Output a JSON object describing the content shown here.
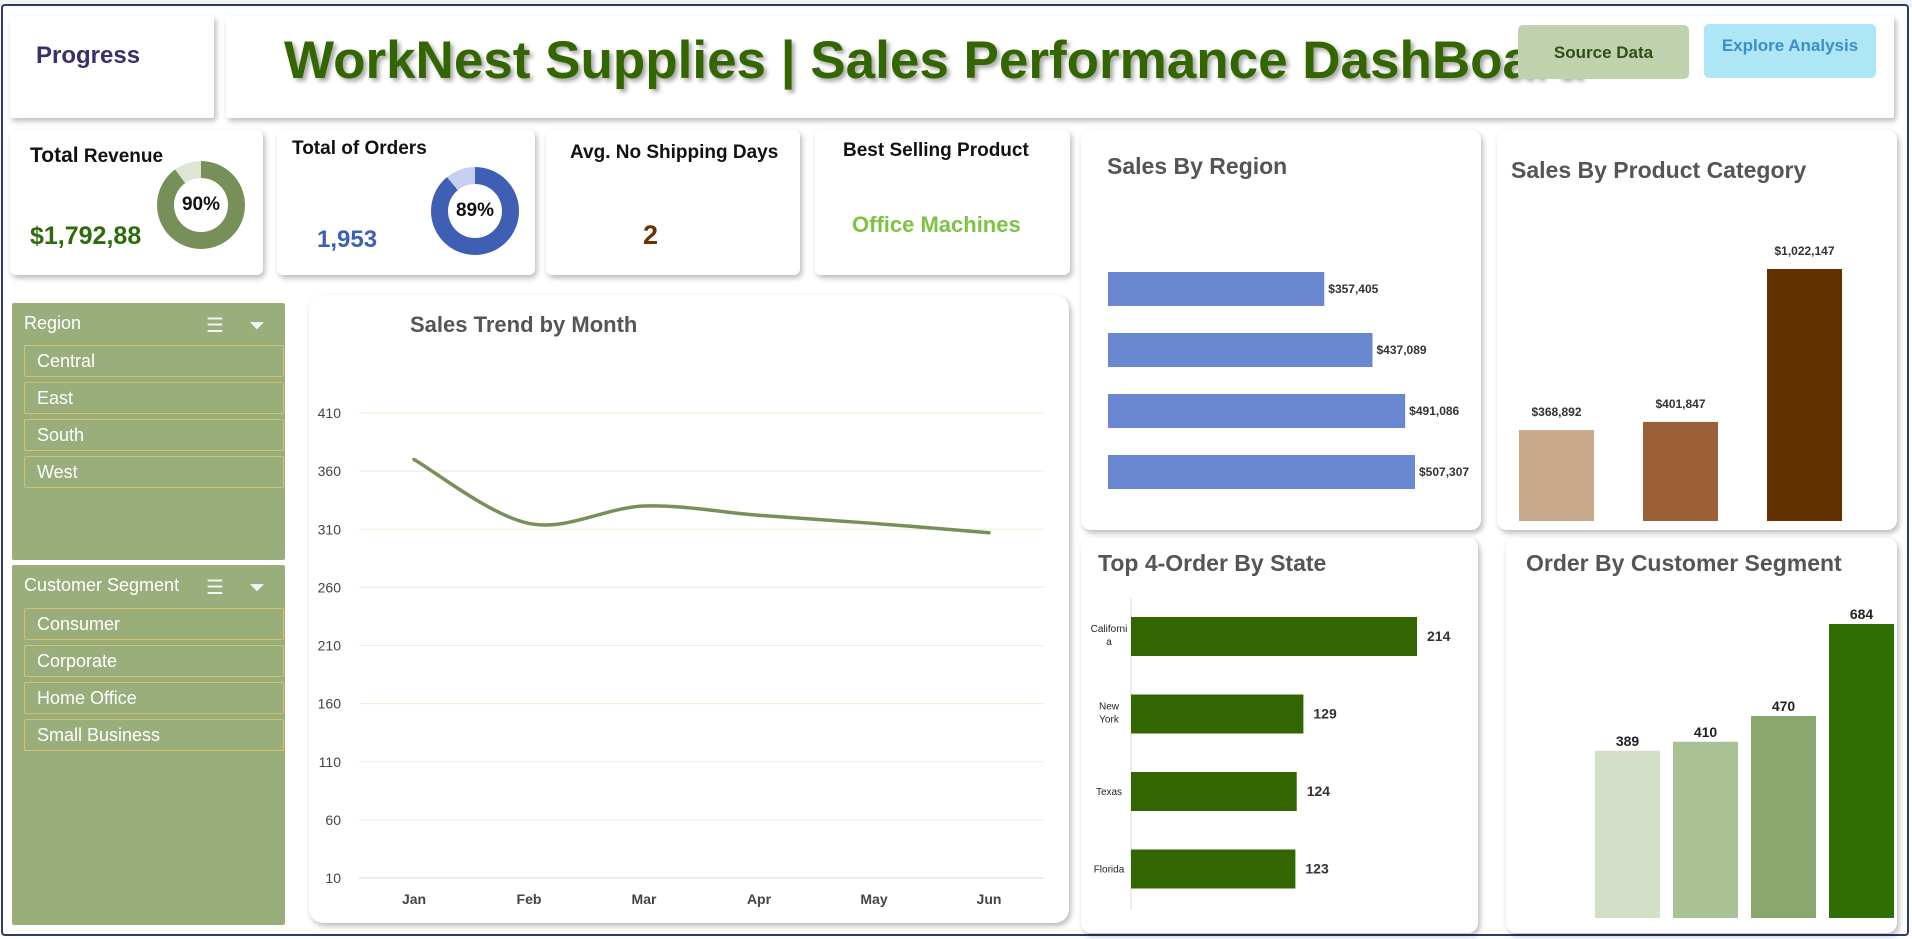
{
  "header": {
    "progress_label": "Progress",
    "title": "WorkNest Supplies | Sales Performance DashBoard",
    "source_button": "Source Data",
    "explore_button": "Explore Analysis"
  },
  "kpis": {
    "revenue": {
      "title_a": "Total",
      "title_b": " Revenue",
      "value": "$1,792,88",
      "percent_label": "90%",
      "percent": 0.9,
      "color": "#77905a"
    },
    "orders": {
      "title": "Total of Orders",
      "value": "1,953",
      "percent_label": "89%",
      "percent": 0.89,
      "color": "#3f5fb5"
    },
    "shipping": {
      "title": "Avg. No Shipping Days",
      "value": "2"
    },
    "best": {
      "title": "Best Selling Product",
      "value": "Office Machines"
    }
  },
  "slicers": {
    "region": {
      "title": "Region",
      "items": [
        "Central",
        "East",
        "South",
        "West"
      ]
    },
    "segment": {
      "title": "Customer Segment",
      "items": [
        "Consumer",
        "Corporate",
        "Home Office",
        "Small Business"
      ]
    }
  },
  "chart_data": [
    {
      "id": "trend",
      "type": "line",
      "title": "Sales Trend by Month",
      "categories": [
        "Jan",
        "Feb",
        "Mar",
        "Apr",
        "May",
        "Jun"
      ],
      "values": [
        370,
        315,
        330,
        322,
        315,
        307
      ],
      "yticks": [
        10,
        60,
        110,
        160,
        210,
        260,
        310,
        360,
        410
      ],
      "ylim": [
        10,
        410
      ],
      "color": "#77905a"
    },
    {
      "id": "region",
      "type": "bar",
      "title": "Sales By Region",
      "values": [
        357405,
        437089,
        491086,
        507307
      ],
      "labels": [
        "$357,405",
        "$437,089",
        "$491,086",
        "$507,307"
      ],
      "color": "#6a87d1"
    },
    {
      "id": "category",
      "type": "bar",
      "title": "Sales By Product Category",
      "values": [
        368892,
        401847,
        1022147
      ],
      "labels": [
        "$368,892",
        "$401,847",
        "$1,022,147"
      ],
      "colors": [
        "#c9a98c",
        "#9b6035",
        "#633000"
      ]
    },
    {
      "id": "state",
      "type": "bar",
      "title": "Top 4-Order By State",
      "categories": [
        "Californi a",
        "New York",
        "Texas",
        "Florida"
      ],
      "values": [
        214,
        129,
        124,
        123
      ],
      "labels": [
        "214",
        "129",
        "124",
        "123"
      ],
      "color": "#336600"
    },
    {
      "id": "segment",
      "type": "bar",
      "title": "Order By Customer Segment",
      "values": [
        389,
        410,
        470,
        684
      ],
      "labels": [
        "389",
        "410",
        "470",
        "684"
      ],
      "colors": [
        "#d4dfc7",
        "#a9c193",
        "#8aa86e",
        "#2f6e00"
      ]
    }
  ]
}
